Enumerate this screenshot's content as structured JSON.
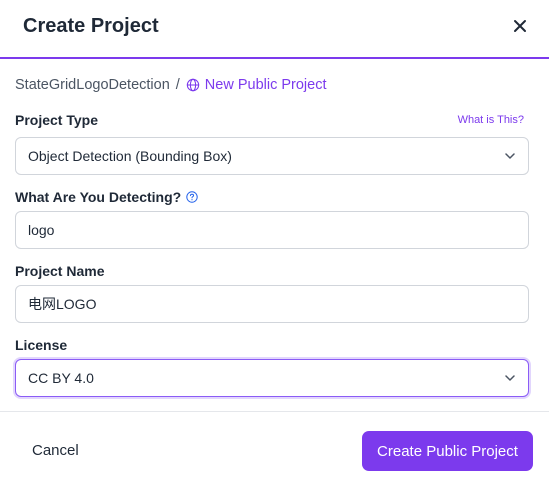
{
  "dialog": {
    "title": "Create Project"
  },
  "breadcrumb": {
    "workspace": "StateGridLogoDetection",
    "separator": "/",
    "new_project": "New Public Project"
  },
  "fields": {
    "project_type": {
      "label": "Project Type",
      "help_link": "What is This?",
      "value": "Object Detection (Bounding Box)"
    },
    "detecting": {
      "label": "What Are You Detecting?",
      "value": "logo"
    },
    "project_name": {
      "label": "Project Name",
      "value": "电网LOGO"
    },
    "license": {
      "label": "License",
      "value": "CC BY 4.0"
    }
  },
  "footer": {
    "cancel_label": "Cancel",
    "create_label": "Create Public Project"
  },
  "icons": {
    "close": "close-icon",
    "globe": "globe-icon",
    "help": "help-circle-icon",
    "chevron": "chevron-down-icon"
  },
  "colors": {
    "accent": "#7c3aed",
    "text": "#1f2937",
    "border": "#d1d5db"
  }
}
